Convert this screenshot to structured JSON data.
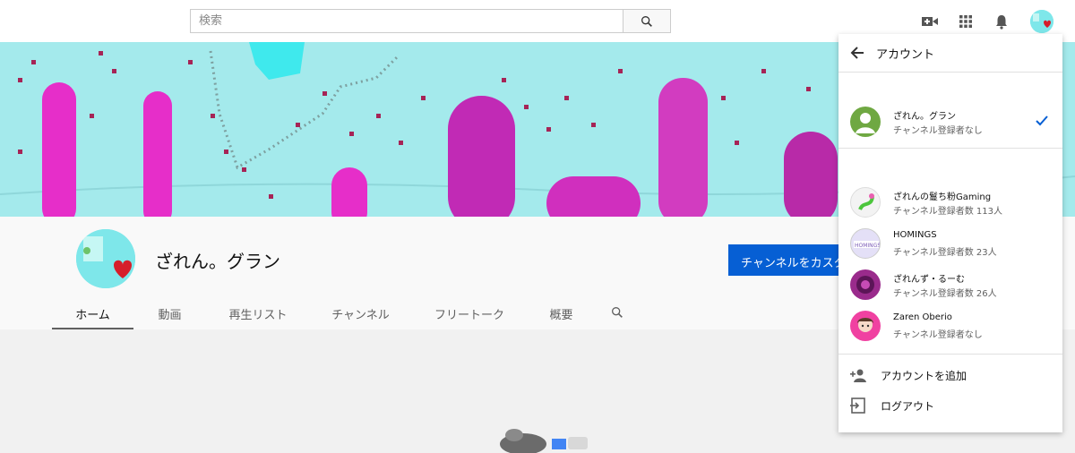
{
  "search": {
    "placeholder": "検索"
  },
  "topbar": {
    "icons": [
      "video-camera-icon",
      "apps-grid-icon",
      "bell-icon",
      "account-avatar"
    ]
  },
  "channel": {
    "name": "ざれん。グラン",
    "customize_label": "チャンネルをカスタマイズ"
  },
  "tabs": [
    {
      "label": "ホーム",
      "active": true
    },
    {
      "label": "動画"
    },
    {
      "label": "再生リスト"
    },
    {
      "label": "チャンネル"
    },
    {
      "label": "フリートーク"
    },
    {
      "label": "概要"
    }
  ],
  "account_menu": {
    "title": "アカウント",
    "current": {
      "name": "ざれん。グラン",
      "subs": "チャンネル登録者なし"
    },
    "others": [
      {
        "name": "ざれんの鬘ち粉Gaming",
        "subs": "チャンネル登録者数 113人"
      },
      {
        "name": "HOMINGS",
        "subs": "チャンネル登録者数 23人"
      },
      {
        "name": "ざれんず・るーむ",
        "subs": "チャンネル登録者数 26人"
      },
      {
        "name": "Zaren Oberio",
        "subs": "チャンネル登録者なし"
      }
    ],
    "add_account": "アカウントを追加",
    "logout": "ログアウト"
  },
  "colors": {
    "accent_blue": "#065fd4",
    "banner_bg": "#a4eaec",
    "banner_magenta": "#e62ec9"
  }
}
